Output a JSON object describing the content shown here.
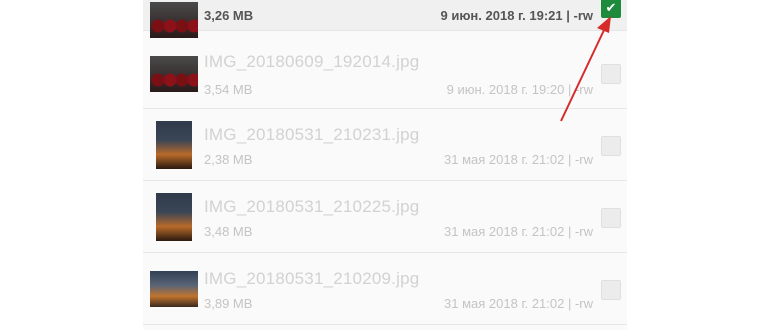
{
  "files": [
    {
      "name": "",
      "size": "3,26 MB",
      "meta": "9 июн. 2018 г. 19:21 | -rw",
      "thumb": "red",
      "checked": true
    },
    {
      "name": "IMG_20180609_192014.jpg",
      "size": "3,54 MB",
      "meta": "9 июн. 2018 г. 19:20 | -rw",
      "thumb": "red",
      "checked": false
    },
    {
      "name": "IMG_20180531_210231.jpg",
      "size": "2,38 MB",
      "meta": "31 мая 2018 г. 21:02 | -rw",
      "thumb": "dark",
      "checked": false
    },
    {
      "name": "IMG_20180531_210225.jpg",
      "size": "3,48 MB",
      "meta": "31 мая 2018 г. 21:02 | -rw",
      "thumb": "dark",
      "checked": false
    },
    {
      "name": "IMG_20180531_210209.jpg",
      "size": "3,89 MB",
      "meta": "31 мая 2018 г. 21:02 | -rw",
      "thumb": "wide",
      "checked": false
    }
  ],
  "colors": {
    "accent": "#1e8a3c",
    "arrow": "#d62b2b"
  },
  "icons": {
    "check": "check-icon",
    "arrow": "red-arrow-annotation"
  }
}
